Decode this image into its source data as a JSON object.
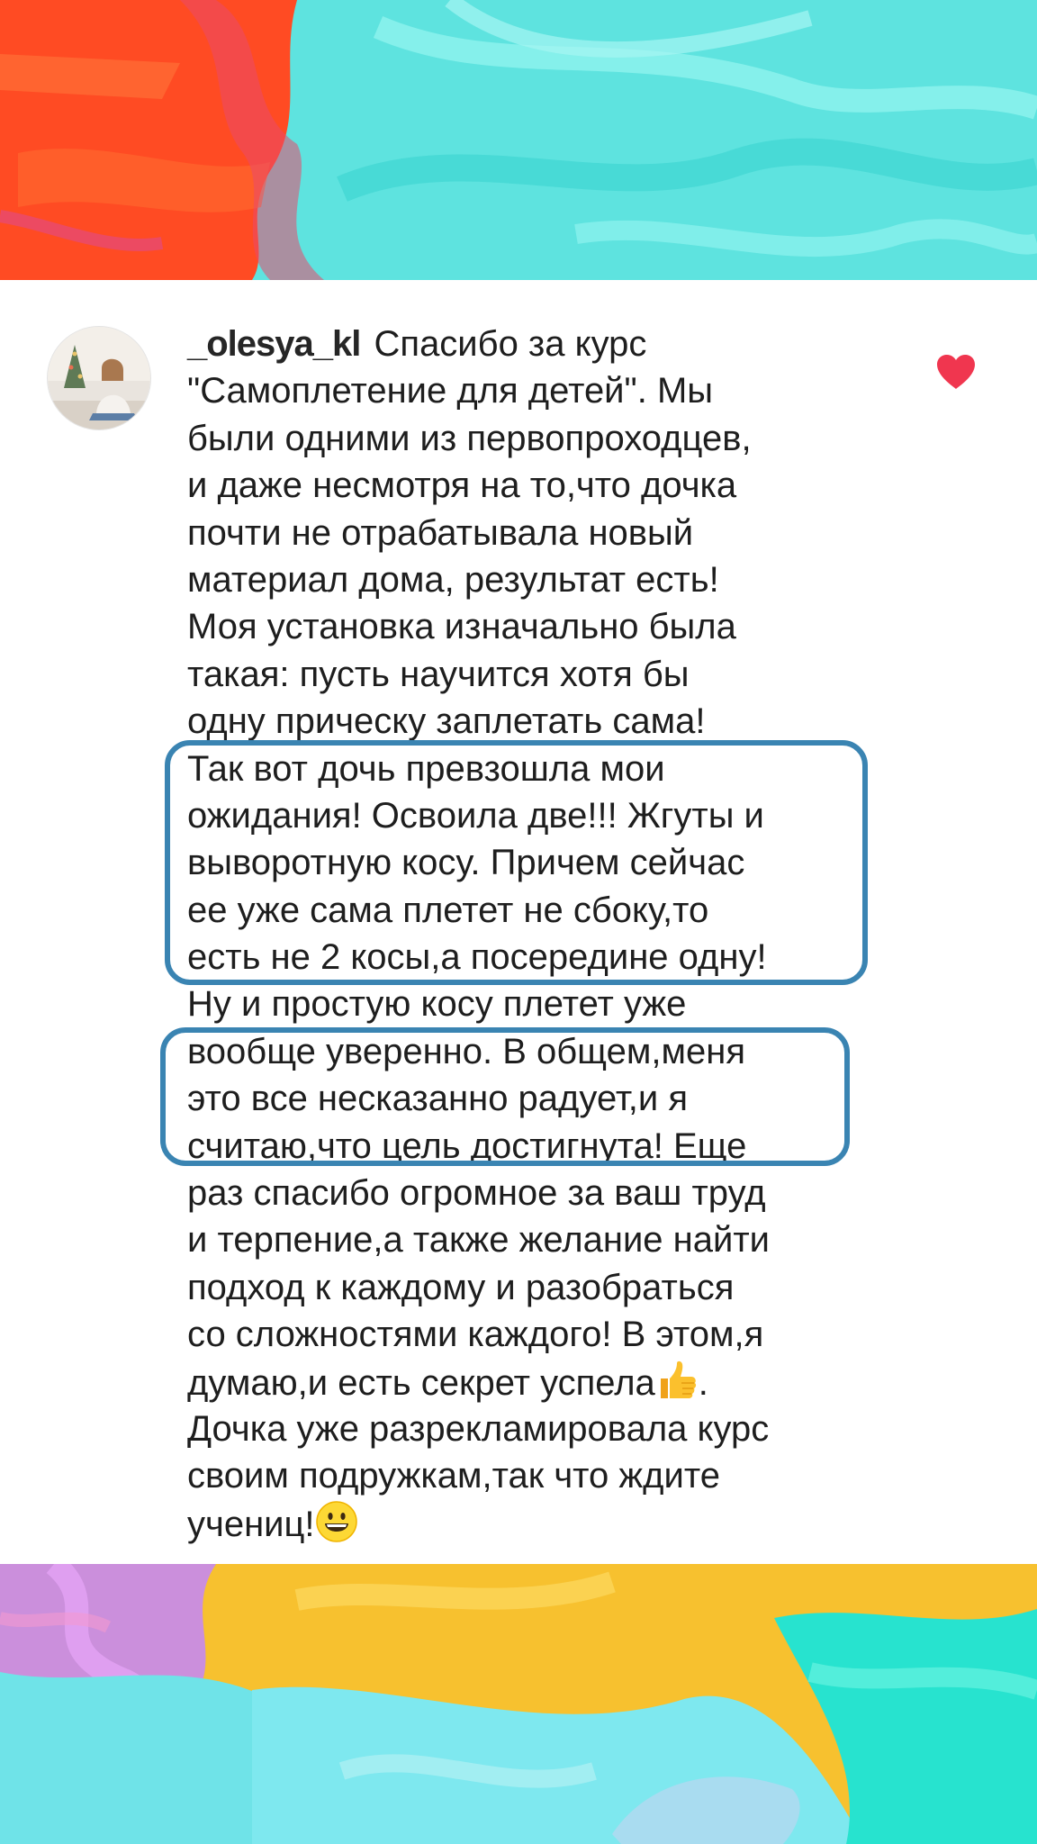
{
  "comment": {
    "username": "_olesya_kl",
    "liked": true,
    "lines": [
      "Спасибо за курс",
      "\"Самоплетение для детей\". Мы",
      "были одними из первопроходцев,",
      "и даже несмотря на то,что дочка",
      "почти не отрабатывала новый",
      "материал дома, результат есть!",
      "Моя установка изначально была",
      "такая: пусть научится хотя бы",
      "одну прическу заплетать сама!",
      "Так вот дочь превзошла мои",
      "ожидания! Освоила две!!! Жгуты и",
      "выворотную косу. Причем сейчас",
      "ее уже сама плетет не сбоку,то",
      "есть не 2 косы,а посередине одну!",
      "Ну и простую косу плетет уже",
      "вообще уверенно. В общем,меня",
      "это все несказанно радует,и я",
      "считаю,что цель достигнута! Еще",
      "раз спасибо огромное за ваш труд",
      "и терпение,а также желание найти",
      "подход к каждому и разобраться",
      "со сложностями каждого! В этом,я"
    ],
    "line_23_text": "думаю,и есть секрет успела",
    "line_23_after": ".",
    "line_24": "Дочка уже разрекламировала курс",
    "line_25": "своим подружкам,так что ждите",
    "line_26_text": "учениц!",
    "icons": {
      "like": "heart-icon",
      "thumb": "thumbs-up-emoji",
      "smile": "grinning-face-emoji"
    },
    "colors": {
      "like": "#f0364f",
      "highlight_border": "#3a84b2",
      "text": "#1e1e1e"
    }
  }
}
